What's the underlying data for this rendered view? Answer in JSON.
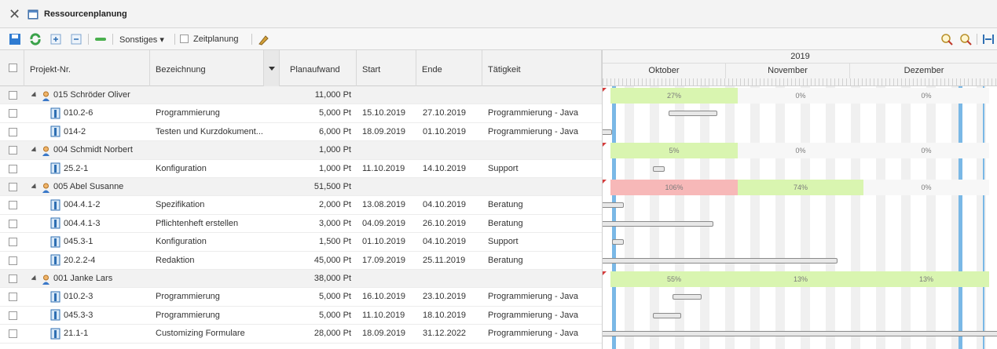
{
  "window": {
    "title": "Ressourcenplanung",
    "close_icon": "close-icon",
    "app_icon": "calendar-icon"
  },
  "toolbar": {
    "sonstiges_label": "Sonstiges ▾",
    "zeitplanung_label": "Zeitplanung"
  },
  "columns": {
    "projekt": "Projekt-Nr.",
    "bezeichnung": "Bezeichnung",
    "planaufwand": "Planaufwand",
    "start": "Start",
    "ende": "Ende",
    "taetigkeit": "Tätigkeit"
  },
  "timeline": {
    "year": "2019",
    "months": [
      "Oktober",
      "November",
      "Dezember"
    ]
  },
  "rows": [
    {
      "type": "group",
      "project": "015 Schröder Oliver",
      "designation": "",
      "effort": "11,000 Pt",
      "start": "",
      "end": "",
      "activity": "",
      "load": [
        "27%",
        "0%",
        "0%"
      ]
    },
    {
      "type": "task",
      "project": "010.2-6",
      "designation": "Programmierung",
      "effort": "5,000 Pt",
      "start": "15.10.2019",
      "end": "27.10.2019",
      "activity": "Programmierung - Java"
    },
    {
      "type": "task",
      "project": "014-2",
      "designation": "Testen und Kurzdokument...",
      "effort": "6,000 Pt",
      "start": "18.09.2019",
      "end": "01.10.2019",
      "activity": "Programmierung - Java"
    },
    {
      "type": "group",
      "project": "004 Schmidt Norbert",
      "designation": "",
      "effort": "1,000 Pt",
      "start": "",
      "end": "",
      "activity": "",
      "load": [
        "5%",
        "0%",
        "0%"
      ]
    },
    {
      "type": "task",
      "project": "25.2-1",
      "designation": "Konfiguration",
      "effort": "1,000 Pt",
      "start": "11.10.2019",
      "end": "14.10.2019",
      "activity": "Support"
    },
    {
      "type": "group",
      "project": "005 Abel Susanne",
      "designation": "",
      "effort": "51,500 Pt",
      "start": "",
      "end": "",
      "activity": "",
      "load": [
        "106%",
        "74%",
        "0%"
      ]
    },
    {
      "type": "task",
      "project": "004.4.1-2",
      "designation": "Spezifikation",
      "effort": "2,000 Pt",
      "start": "13.08.2019",
      "end": "04.10.2019",
      "activity": "Beratung"
    },
    {
      "type": "task",
      "project": "004.4.1-3",
      "designation": "Pflichtenheft erstellen",
      "effort": "3,000 Pt",
      "start": "04.09.2019",
      "end": "26.10.2019",
      "activity": "Beratung"
    },
    {
      "type": "task",
      "project": "045.3-1",
      "designation": "Konfiguration",
      "effort": "1,500 Pt",
      "start": "01.10.2019",
      "end": "04.10.2019",
      "activity": "Support"
    },
    {
      "type": "task",
      "project": "20.2.2-4",
      "designation": "Redaktion",
      "effort": "45,000 Pt",
      "start": "17.09.2019",
      "end": "25.11.2019",
      "activity": "Beratung"
    },
    {
      "type": "group",
      "project": "001 Janke Lars",
      "designation": "",
      "effort": "38,000 Pt",
      "start": "",
      "end": "",
      "activity": "",
      "load": [
        "55%",
        "13%",
        "13%"
      ]
    },
    {
      "type": "task",
      "project": "010.2-3",
      "designation": "Programmierung",
      "effort": "5,000 Pt",
      "start": "16.10.2019",
      "end": "23.10.2019",
      "activity": "Programmierung - Java"
    },
    {
      "type": "task",
      "project": "045.3-3",
      "designation": "Programmierung",
      "effort": "5,000 Pt",
      "start": "11.10.2019",
      "end": "18.10.2019",
      "activity": "Programmierung - Java"
    },
    {
      "type": "task",
      "project": "21.1-1",
      "designation": "Customizing Formulare",
      "effort": "28,000 Pt",
      "start": "18.09.2019",
      "end": "31.12.2022",
      "activity": "Programmierung - Java"
    }
  ],
  "colors": {
    "load_ok": "#d9f5b0",
    "load_over": "#f7b8b8",
    "load_zero": "#f7f7f7",
    "today": "#7ab8e6"
  }
}
